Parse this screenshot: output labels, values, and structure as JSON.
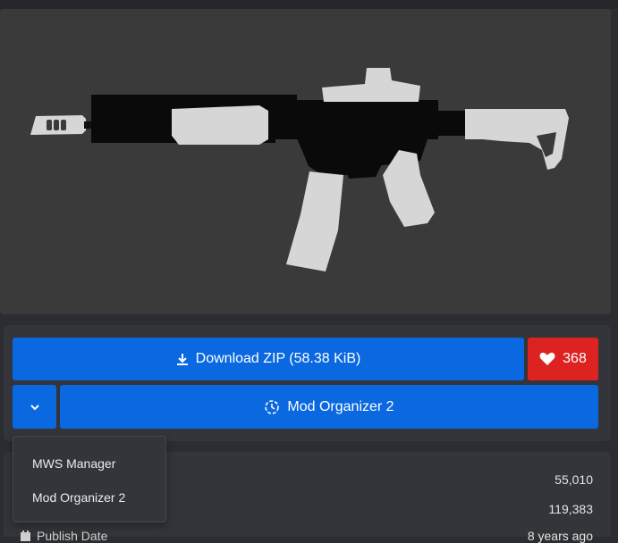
{
  "download": {
    "label": "Download ZIP (58.38 KiB)",
    "icon": "download-icon",
    "color": "#0a68e0"
  },
  "likes": {
    "count": "368",
    "icon": "heart-icon",
    "color": "#dd2222"
  },
  "manager": {
    "selected": "Mod Organizer 2",
    "icon": "mod-organizer-icon",
    "toggle_icon": "chevron-down-icon"
  },
  "dropdown": {
    "items": [
      {
        "label": "MWS Manager"
      },
      {
        "label": "Mod Organizer 2"
      }
    ]
  },
  "stats": {
    "values": [
      "55,010",
      "119,383"
    ],
    "publish_label": "Publish Date",
    "publish_icon": "calendar-icon",
    "publish_value": "8 years ago"
  }
}
